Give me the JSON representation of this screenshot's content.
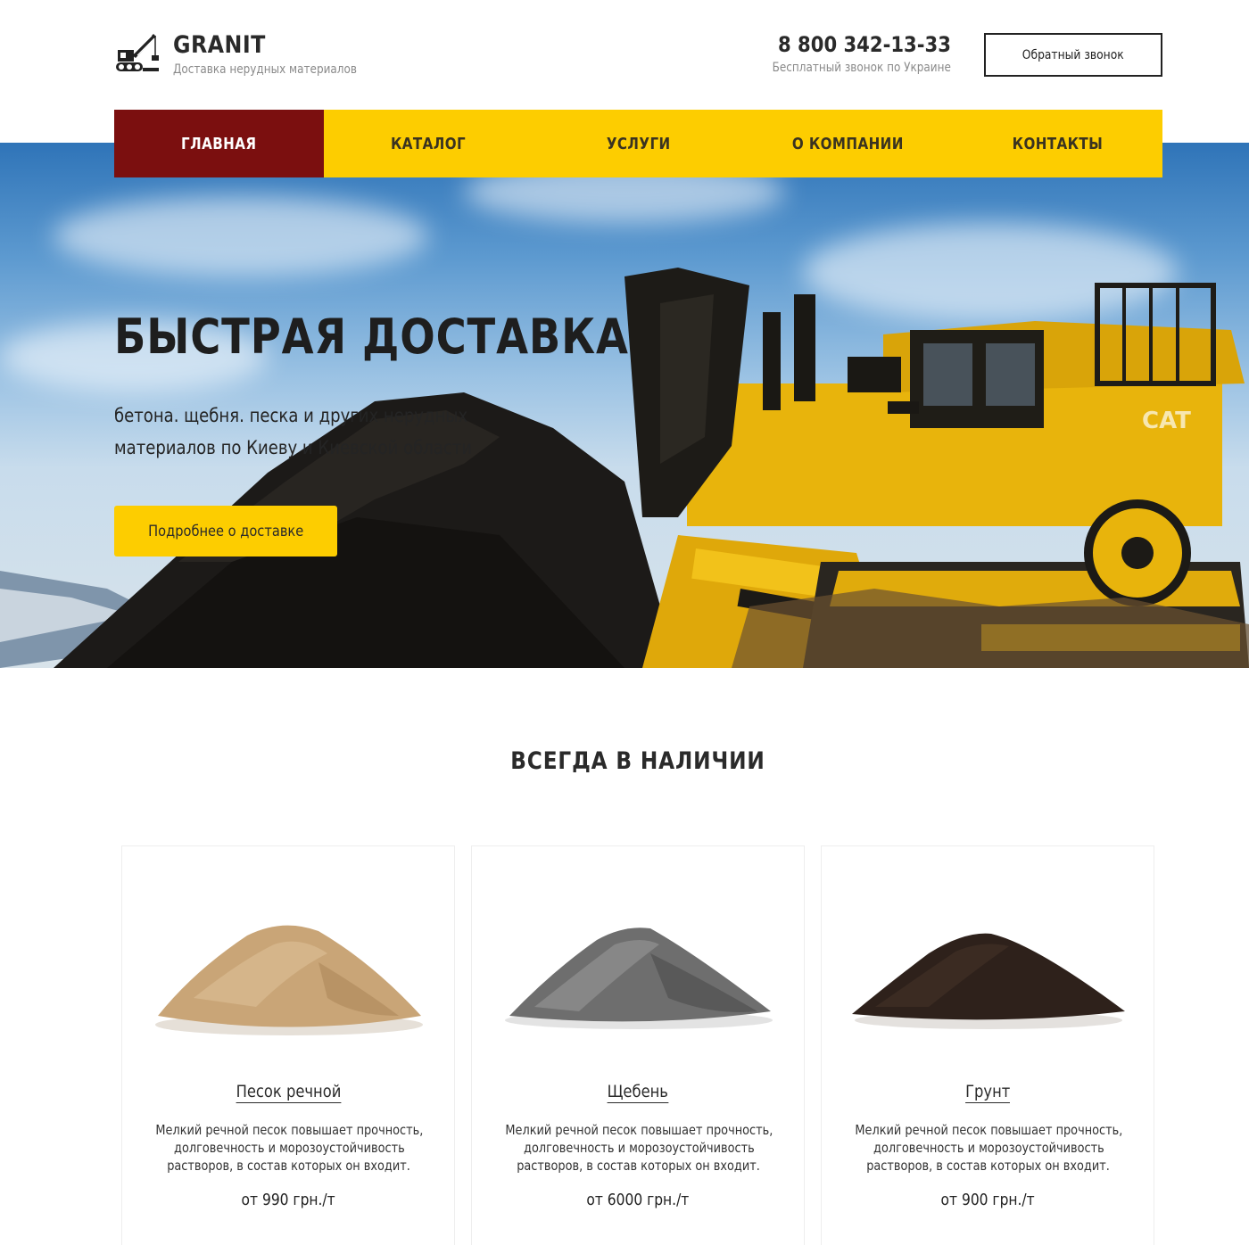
{
  "header": {
    "brand": "GRANIT",
    "tagline": "Доставка нерудных материалов",
    "phone": "8 800 342-13-33",
    "phone_note": "Бесплатный звонок по Украине",
    "callback_label": "Обратный звонок"
  },
  "nav": [
    {
      "label": "ГЛАВНАЯ",
      "active": true
    },
    {
      "label": "КАТАЛОГ",
      "active": false
    },
    {
      "label": "УСЛУГИ",
      "active": false
    },
    {
      "label": "О КОМПАНИИ",
      "active": false
    },
    {
      "label": "КОНТАКТЫ",
      "active": false
    }
  ],
  "hero": {
    "title": "БЫСТРАЯ ДОСТАВКА",
    "text_line1": "бетона. щебня. песка и других нерудных",
    "text_line2": "материалов по Киеву и Киевской области",
    "button_label": "Подробнее о доставке"
  },
  "section": {
    "title": "ВСЕГДА В НАЛИЧИИ"
  },
  "products": [
    {
      "name": "Песок речной",
      "desc_line1": "Мелкий речной песок повышает прочность,",
      "desc_line2": "долговечность и морозоустойчивость",
      "desc_line3": "растворов, в состав которых он входит.",
      "price": "от 990 грн./т",
      "color": "#c9a577"
    },
    {
      "name": "Щебень",
      "desc_line1": "Мелкий речной песок повышает прочность,",
      "desc_line2": "долговечность и морозоустойчивость",
      "desc_line3": "растворов, в состав которых он входит.",
      "price": "от 6000 грн./т",
      "color": "#6e6e6e"
    },
    {
      "name": "Грунт",
      "desc_line1": "Мелкий речной песок повышает прочность,",
      "desc_line2": "долговечность и морозоустойчивость",
      "desc_line3": "растворов, в состав которых он входит.",
      "price": "от 900 грн./т",
      "color": "#2e211b"
    }
  ],
  "colors": {
    "accent": "#fdcd00",
    "nav_active": "#7b0f0f"
  }
}
